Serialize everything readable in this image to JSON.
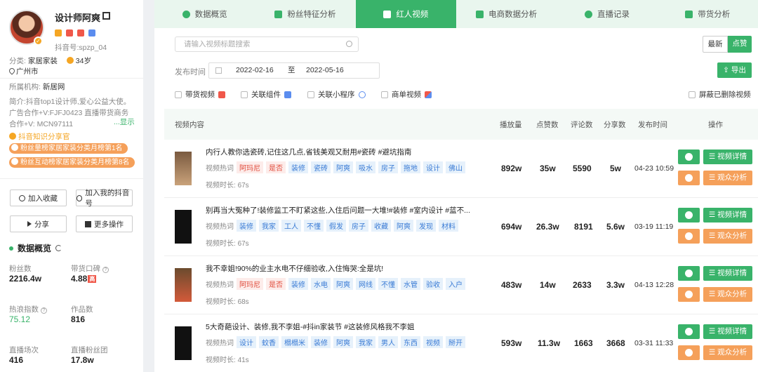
{
  "profile": {
    "name": "设计师阿爽",
    "douyin_id": "抖音号:spzp_04",
    "category_label": "分类:",
    "category": "家居家装",
    "age": "34岁",
    "location": "广州市",
    "org_label": "所属机构:",
    "org": "新居网",
    "intro": "简介:抖音top1设计师,爱心公益大使。广告合作+V:FJFJ0423 直播带货商务合作+V: MCN97111",
    "more": "...显示",
    "honor": "抖音知识分享官",
    "ranks": [
      "粉丝量榜家居家装分类月榜第1名",
      "粉丝互动榜家居家装分类月榜第8名"
    ]
  },
  "sidebar_buttons": {
    "favorite": "加入收藏",
    "add_mine": "加入我的抖音号",
    "share": "分享",
    "more_ops": "更多操作"
  },
  "overview": {
    "title": "数据概览",
    "stats": [
      {
        "label": "粉丝数",
        "value": "2216.4w"
      },
      {
        "label": "带货口碑",
        "value": "4.88",
        "tag": "高"
      },
      {
        "label": "热浪指数",
        "value": "75.12"
      },
      {
        "label": "作品数",
        "value": "816"
      },
      {
        "label": "直播场次",
        "value": "416"
      },
      {
        "label": "直播粉丝团",
        "value": "17.8w"
      }
    ]
  },
  "tabs": [
    "数据概览",
    "粉丝特征分析",
    "红人视频",
    "电商数据分析",
    "直播记录",
    "带货分析"
  ],
  "search": {
    "placeholder": "请输入视频标题搜索"
  },
  "sort": {
    "latest": "最新",
    "likes": "点赞"
  },
  "date": {
    "label": "发布时间",
    "start": "2022-02-16",
    "sep": "至",
    "end": "2022-05-16"
  },
  "export_label": "导出",
  "filters": [
    "带货视频",
    "关联组件",
    "关联小程序",
    "商单视频"
  ],
  "hide_deleted": "屏蔽已删除视频",
  "table": {
    "headers": [
      "视频内容",
      "播放量",
      "点赞数",
      "评论数",
      "分享数",
      "发布时间",
      "操作"
    ],
    "hot_label": "视频热词",
    "dur_label": "视频时长:",
    "detail_label": "视频详情",
    "audience_label": "观众分析",
    "rows": [
      {
        "title": "内行人教你选瓷砖,记住这几点,省钱美观又耐用#瓷砖 #避坑指南",
        "keywords": [
          "阿玛尼",
          "是否",
          "装修",
          "瓷砖",
          "阿爽",
          "吸水",
          "房子",
          "拖地",
          "设计",
          "佛山"
        ],
        "duration": "67s",
        "plays": "892w",
        "likes": "35w",
        "comments": "5590",
        "shares": "5w",
        "time": "04-23 10:59"
      },
      {
        "title": "别再当大冤种了!装修监工不盯紧这些,入住后问题一大堆!#装修 #室内设计 #蓝不...",
        "keywords": [
          "装修",
          "我家",
          "工人",
          "不懂",
          "假发",
          "房子",
          "收藏",
          "阿爽",
          "发现",
          "材料"
        ],
        "duration": "67s",
        "plays": "694w",
        "likes": "26.3w",
        "comments": "8191",
        "shares": "5.6w",
        "time": "03-19 11:19"
      },
      {
        "title": "我不幸姐!90%的业主水电不仔细验收,入住悔哭:全是坑!",
        "keywords": [
          "阿玛尼",
          "是否",
          "装修",
          "水电",
          "阿爽",
          "网线",
          "不懂",
          "水管",
          "验收",
          "入户"
        ],
        "duration": "68s",
        "plays": "483w",
        "likes": "14w",
        "comments": "2633",
        "shares": "3.3w",
        "time": "04-13 12:28"
      },
      {
        "title": "5大奇葩设计、装修,我不李姐-#抖in家装节 #这装修风格我不李姐",
        "keywords": [
          "设计",
          "蚊香",
          "榻榻米",
          "装修",
          "阿爽",
          "我家",
          "男人",
          "东西",
          "视频",
          "掰开"
        ],
        "duration": "41s",
        "plays": "593w",
        "likes": "11.3w",
        "comments": "1663",
        "shares": "3668",
        "time": "03-31 11:33"
      }
    ]
  },
  "colors": {
    "accent": "#39b36a",
    "orange": "#f5a05a",
    "tag_blue": "#3a7bd5",
    "tag_red": "#e04a3a"
  }
}
